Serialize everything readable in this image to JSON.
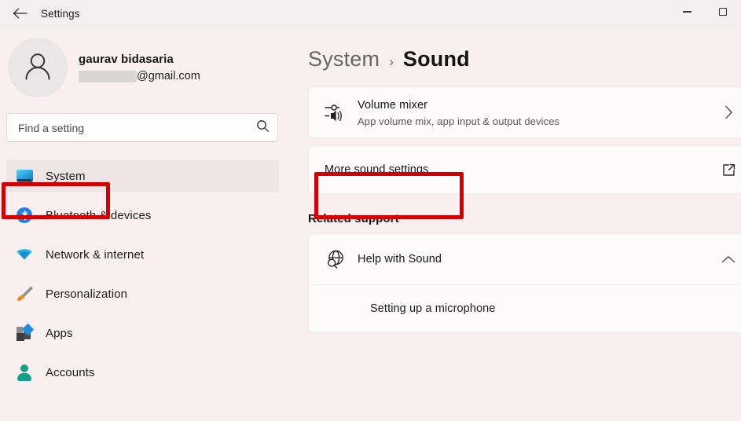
{
  "titlebar": {
    "back_icon": "arrow-left-icon",
    "title": "Settings",
    "minimize_label": "Minimize",
    "maximize_label": "Maximize"
  },
  "account": {
    "avatar_icon": "person-avatar-icon",
    "name": "gaurav bidasaria",
    "email_domain": "@gmail.com",
    "email_redacted": true
  },
  "search": {
    "placeholder": "Find a setting",
    "value": "",
    "icon": "search-icon"
  },
  "sidebar": {
    "items": [
      {
        "label": "System",
        "icon": "monitor-icon",
        "selected": true,
        "highlighted": true
      },
      {
        "label": "Bluetooth & devices",
        "icon": "bluetooth-icon",
        "selected": false,
        "highlighted": false
      },
      {
        "label": "Network & internet",
        "icon": "wifi-icon",
        "selected": false,
        "highlighted": false
      },
      {
        "label": "Personalization",
        "icon": "paintbrush-icon",
        "selected": false,
        "highlighted": false
      },
      {
        "label": "Apps",
        "icon": "apps-icon",
        "selected": false,
        "highlighted": false
      },
      {
        "label": "Accounts",
        "icon": "account-person-icon",
        "selected": false,
        "highlighted": false
      }
    ]
  },
  "breadcrumb": {
    "parent": "System",
    "separator": "›",
    "current": "Sound"
  },
  "main": {
    "volume_mixer": {
      "title": "Volume mixer",
      "subtitle": "App volume mix, app input & output devices",
      "icon": "volume-mixer-icon",
      "action_icon": "chevron-right-icon"
    },
    "more_sound_settings": {
      "title": "More sound settings",
      "action_icon": "external-link-icon",
      "highlighted": true
    },
    "related_support": {
      "heading": "Related support",
      "help": {
        "title": "Help with Sound",
        "icon": "globe-search-icon",
        "action_icon": "chevron-up-icon"
      },
      "links": [
        {
          "label": "Setting up a microphone"
        }
      ]
    }
  },
  "colors": {
    "background": "#f9eff1",
    "card": "#fcfafa",
    "selected_row": "#eee4e6",
    "annotation": "#d40000",
    "accent_blue": "#1f8ee0",
    "accent_teal": "#12a08a"
  }
}
